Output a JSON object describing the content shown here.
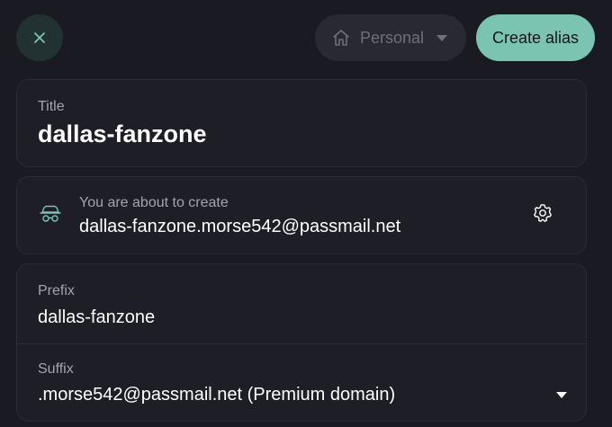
{
  "header": {
    "close_icon": "close-icon",
    "vault": {
      "icon": "home-icon",
      "label": "Personal"
    },
    "create_button_label": "Create alias"
  },
  "title_field": {
    "label": "Title",
    "value": "dallas-fanzone"
  },
  "alias_preview": {
    "icon": "incognito-icon",
    "label": "You are about to create",
    "address": "dallas-fanzone.morse542@passmail.net",
    "settings_icon": "gear-icon"
  },
  "prefix_field": {
    "label": "Prefix",
    "value": "dallas-fanzone"
  },
  "suffix_field": {
    "label": "Suffix",
    "value": ".morse542@passmail.net (Premium domain)"
  },
  "colors": {
    "background": "#1a1a23",
    "card": "#1e1e27",
    "accent": "#7cc4b2",
    "close_button_bg": "#223232",
    "muted_text": "#a4a4b0"
  }
}
